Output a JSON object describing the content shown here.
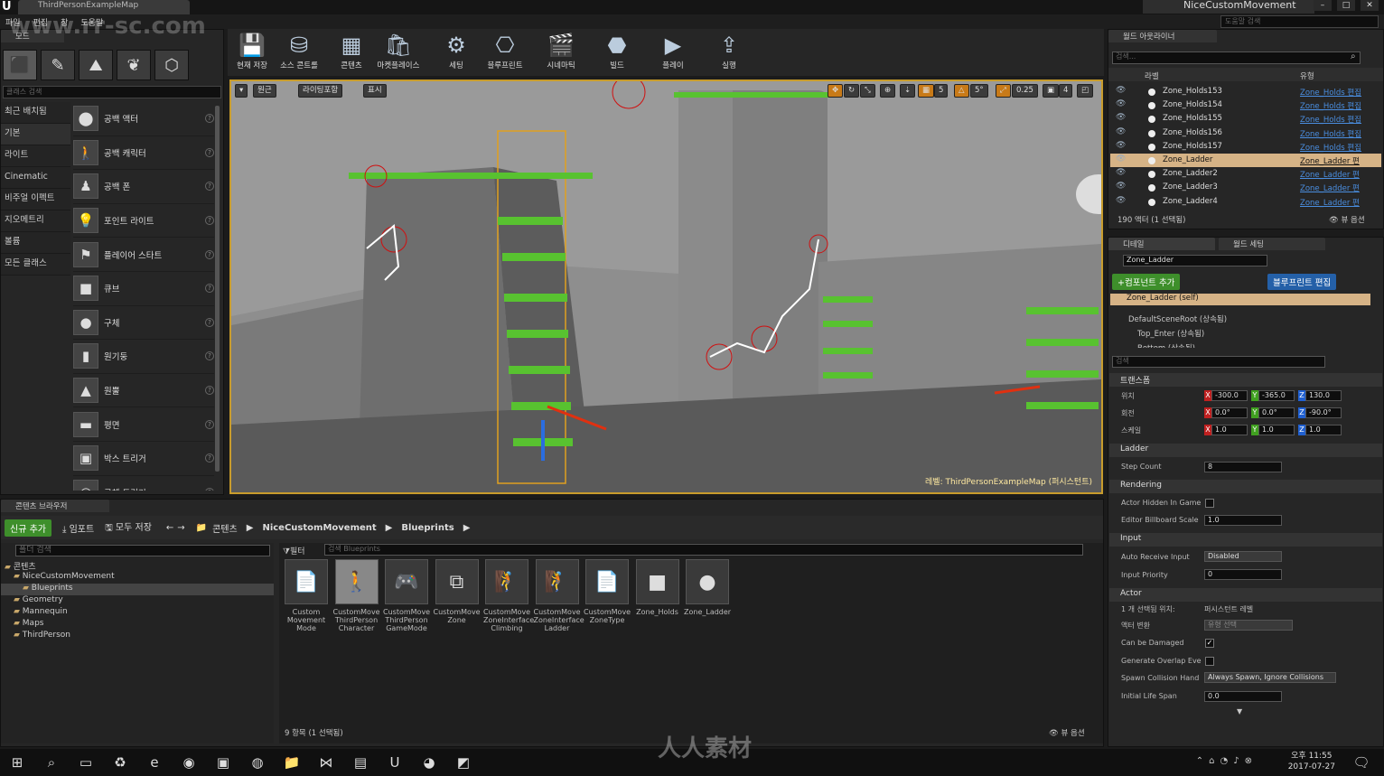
{
  "window": {
    "tab_title": "ThirdPersonExampleMap",
    "project_name": "NiceCustomMovement",
    "help_search_placeholder": "도움말 검색",
    "buttons": [
      "–",
      "□",
      "✕"
    ]
  },
  "menu": [
    "파일",
    "편집",
    "창",
    "도움말"
  ],
  "modes": {
    "tab_label": "모드",
    "search_placeholder": "클래스 검색",
    "categories": [
      "최근 배치됨",
      "기본",
      "라이트",
      "Cinematic",
      "비주얼 이펙트",
      "지오메트리",
      "볼륨",
      "모든 클래스"
    ],
    "selected_category": 1,
    "items": [
      {
        "label": "공백 액터",
        "icon": "⬤"
      },
      {
        "label": "공백 캐릭터",
        "icon": "🚶"
      },
      {
        "label": "공백 폰",
        "icon": "♟"
      },
      {
        "label": "포인트 라이트",
        "icon": "💡"
      },
      {
        "label": "플레이어 스타트",
        "icon": "⚑"
      },
      {
        "label": "큐브",
        "icon": "■"
      },
      {
        "label": "구체",
        "icon": "●"
      },
      {
        "label": "원기둥",
        "icon": "▮"
      },
      {
        "label": "원뿔",
        "icon": "▲"
      },
      {
        "label": "평면",
        "icon": "▬"
      },
      {
        "label": "박스 트리거",
        "icon": "▣"
      },
      {
        "label": "구체 트리거",
        "icon": "◎"
      }
    ]
  },
  "toolbar": {
    "buttons": [
      {
        "label": "현재 저장",
        "icon": "💾"
      },
      {
        "label": "소스 콘트롤",
        "icon": "⛁"
      },
      {
        "label": "콘텐츠",
        "icon": "▦"
      },
      {
        "label": "마켓플레이스",
        "icon": "🛍"
      },
      {
        "label": "세팅",
        "icon": "⚙"
      },
      {
        "label": "블루프린트",
        "icon": "⎔"
      },
      {
        "label": "시네마틱",
        "icon": "🎬"
      },
      {
        "label": "빌드",
        "icon": "⬣"
      },
      {
        "label": "플레이",
        "icon": "▶"
      },
      {
        "label": "실행",
        "icon": "⇪"
      }
    ]
  },
  "viewport": {
    "perspective_label": "원근",
    "lighting_label": "라이팅포함",
    "show_label": "표시",
    "grid_snap": "5",
    "rot_snap": "5°",
    "scale_snap": "0.25",
    "camera_speed": "4",
    "level_label": "레벨: ThirdPersonExampleMap (퍼시스턴트)"
  },
  "outliner": {
    "tab_label": "월드 아웃라이너",
    "search_placeholder": "검색...",
    "col_label": "라벨",
    "col_type": "유형",
    "rows": [
      {
        "name": "Zone_Holds153",
        "type": "Zone_Holds 편집"
      },
      {
        "name": "Zone_Holds154",
        "type": "Zone_Holds 편집"
      },
      {
        "name": "Zone_Holds155",
        "type": "Zone_Holds 편집"
      },
      {
        "name": "Zone_Holds156",
        "type": "Zone_Holds 편집"
      },
      {
        "name": "Zone_Holds157",
        "type": "Zone_Holds 편집"
      },
      {
        "name": "Zone_Ladder",
        "type": "Zone_Ladder 편"
      },
      {
        "name": "Zone_Ladder2",
        "type": "Zone_Ladder 편"
      },
      {
        "name": "Zone_Ladder3",
        "type": "Zone_Ladder 편"
      },
      {
        "name": "Zone_Ladder4",
        "type": "Zone_Ladder 편"
      }
    ],
    "selected_row": 5,
    "status": "190 액터 (1 선택됨)",
    "view_options": "뷰 옵션"
  },
  "details": {
    "tab_label": "디테일",
    "world_settings_tab": "월드 세팅",
    "actor_name": "Zone_Ladder",
    "add_component": "+컴포넌트 추가",
    "edit_blueprint": "블루프린트 편집",
    "components": [
      "Zone_Ladder (self)",
      "DefaultSceneRoot (상속됨)",
      "Top_Enter (상속됨)",
      "Bottom (상속됨)"
    ],
    "search_placeholder": "검색",
    "transform": {
      "section": "트랜스폼",
      "location_label": "위치",
      "rotation_label": "회전",
      "scale_label": "스케일",
      "location": [
        "-300.0",
        "-365.0",
        "130.0"
      ],
      "rotation": [
        "0.0°",
        "0.0°",
        "-90.0°"
      ],
      "scale": [
        "1.0",
        "1.0",
        "1.0"
      ]
    },
    "ladder": {
      "section": "Ladder",
      "step_count_label": "Step Count",
      "step_count": "8"
    },
    "rendering": {
      "section": "Rendering",
      "hidden_label": "Actor Hidden In Game",
      "hidden": false,
      "billboard_label": "Editor Billboard Scale",
      "billboard": "1.0"
    },
    "input": {
      "section": "Input",
      "auto_receive_label": "Auto Receive Input",
      "auto_receive": "Disabled",
      "priority_label": "Input Priority",
      "priority": "0"
    },
    "actor": {
      "section": "Actor",
      "selected_in_label": "1 개 선택됨 위치:",
      "selected_in": "퍼시스턴트 레벨",
      "convert_label": "액터 변환",
      "convert_value": "유형 선택",
      "can_damage_label": "Can be Damaged",
      "can_damage": true,
      "overlap_label": "Generate Overlap Eve",
      "overlap": false,
      "spawn_label": "Spawn Collision Hand",
      "spawn_value": "Always Spawn, Ignore Collisions",
      "life_label": "Initial Life Span",
      "life_value": "0.0"
    }
  },
  "content_browser": {
    "tab_label": "콘텐츠 브라우저",
    "add_new": "신규 추가",
    "import": "임포트",
    "save_all": "모두 저장",
    "path": [
      "콘텐츠",
      "NiceCustomMovement",
      "Blueprints"
    ],
    "folder_search_placeholder": "폴더 검색",
    "filter_label": "필터",
    "asset_search_placeholder": "검색 Blueprints",
    "tree": [
      {
        "label": "콘텐츠",
        "depth": 0
      },
      {
        "label": "NiceCustomMovement",
        "depth": 1
      },
      {
        "label": "Blueprints",
        "depth": 2
      },
      {
        "label": "Geometry",
        "depth": 1
      },
      {
        "label": "Mannequin",
        "depth": 1
      },
      {
        "label": "Maps",
        "depth": 1
      },
      {
        "label": "ThirdPerson",
        "depth": 1
      }
    ],
    "assets": [
      {
        "name": "Custom Movement Mode",
        "icon": "📄"
      },
      {
        "name": "CustomMove ThirdPerson Character",
        "icon": "🚶"
      },
      {
        "name": "CustomMove ThirdPerson GameMode",
        "icon": "🎮"
      },
      {
        "name": "CustomMove Zone",
        "icon": "⧉"
      },
      {
        "name": "CustomMove ZoneInterface Climbing",
        "icon": "🧗"
      },
      {
        "name": "CustomMove ZoneInterface Ladder",
        "icon": "🧗"
      },
      {
        "name": "CustomMove ZoneType",
        "icon": "📄"
      },
      {
        "name": "Zone_Holds",
        "icon": "■"
      },
      {
        "name": "Zone_Ladder",
        "icon": "●"
      }
    ],
    "status": "9 항목 (1 선택됨)",
    "view_options": "뷰 옵션"
  },
  "taskbar": {
    "time": "오후 11:55",
    "date": "2017-07-27"
  },
  "watermarks": [
    "www.rr-sc.com",
    "人人素材"
  ]
}
